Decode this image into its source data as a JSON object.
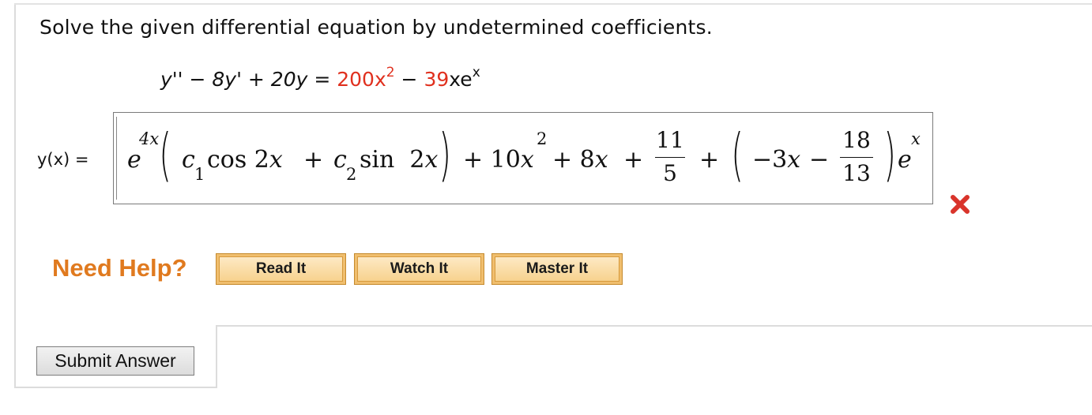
{
  "question": "Solve the given differential equation by undetermined coefficients.",
  "equation": {
    "lhs": "y'' − 8y' + 20y =",
    "rhs_term1_coef": "200",
    "rhs_term1_var": "x",
    "rhs_term1_exp": "2",
    "rhs_minus": "−",
    "rhs_term2_coef": "39",
    "rhs_term2_var": "xe",
    "rhs_term2_exp": "x"
  },
  "answer": {
    "label": "y(x) =",
    "e": "e",
    "e_exp": "4x",
    "c1": "c",
    "c1_sub": "1",
    "cos": "cos 2",
    "cos_x": "x",
    "plus1": "+",
    "c2": "c",
    "c2_sub": "2",
    "sin": "sin  2",
    "sin_x": "x",
    "term_10x": "+ 10",
    "term_10x_var": "x",
    "term_10x_exp": "2",
    "term_8x": "+ 8",
    "term_8x_var": "x",
    "plus2": "+",
    "frac1_num": "11",
    "frac1_den": "5",
    "plus3": "+",
    "neg3x": "−3",
    "neg3x_var": "x",
    "minus": "−",
    "frac2_num": "18",
    "frac2_den": "13",
    "e2": "e",
    "e2_exp": "x",
    "status": "incorrect",
    "status_color": "#d9342b"
  },
  "help": {
    "label": "Need Help?",
    "buttons": [
      "Read It",
      "Watch It",
      "Master It"
    ]
  },
  "submit_label": "Submit Answer",
  "colors": {
    "accent_orange": "#e07a1f",
    "red": "#e0301e"
  },
  "icons": {
    "status": "x-mark-icon"
  }
}
